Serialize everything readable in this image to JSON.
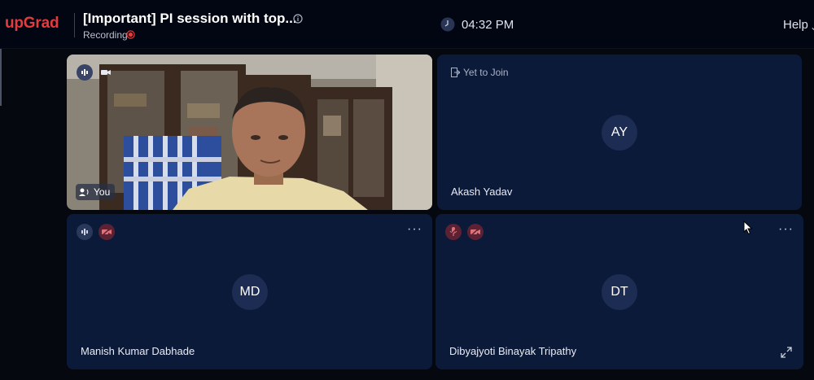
{
  "header": {
    "logo": "upGrad",
    "title": "[Important] PI session with top...",
    "recording_label": "Recording",
    "time": "04:32 PM",
    "help": "Help",
    "help_edge": "⌄"
  },
  "participants": [
    {
      "name": "You",
      "initials": "",
      "video_on": true
    },
    {
      "name": "Akash Yadav",
      "initials": "AY",
      "status": "Yet to Join"
    },
    {
      "name": "Manish Kumar Dabhade",
      "initials": "MD"
    },
    {
      "name": "Dibyajyoti Binayak Tripathy",
      "initials": "DT"
    }
  ],
  "more_label": "···",
  "colors": {
    "brand": "#e43b3e",
    "tile_bg": "#0c1a3a",
    "avatar_bg": "#1c2c53",
    "muted_bg": "#5c2233",
    "recording": "#e43b3e"
  },
  "icons": [
    "info-icon",
    "recording-dot-icon",
    "clock-icon",
    "audio-level-icon",
    "video-camera-icon",
    "video-off-icon",
    "mic-off-icon",
    "speaker-icon",
    "join-icon",
    "more-icon",
    "expand-icon",
    "mouse-cursor-icon"
  ]
}
